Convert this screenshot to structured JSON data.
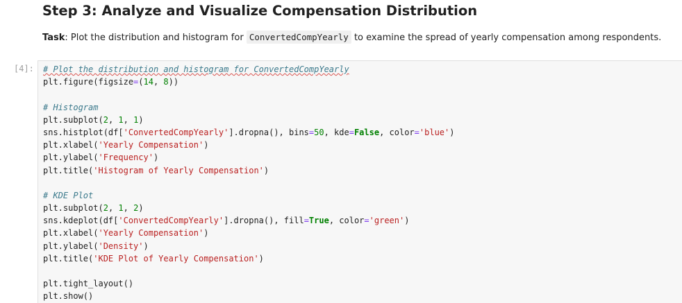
{
  "heading": "Step 3: Analyze and Visualize Compensation Distribution",
  "task": {
    "label": "Task",
    "before": ": Plot the distribution and histogram for ",
    "code": "ConvertedCompYearly",
    "after": " to examine the spread of yearly compensation among respondents."
  },
  "cell": {
    "prompt": "[4]:",
    "lines": [
      "# Plot the distribution and histogram for ConvertedCompYearly",
      "plt.figure(figsize=(14, 8))",
      "",
      "# Histogram",
      "plt.subplot(2, 1, 1)",
      "sns.histplot(df['ConvertedCompYearly'].dropna(), bins=50, kde=False, color='blue')",
      "plt.xlabel('Yearly Compensation')",
      "plt.ylabel('Frequency')",
      "plt.title('Histogram of Yearly Compensation')",
      "",
      "# KDE Plot",
      "plt.subplot(2, 1, 2)",
      "sns.kdeplot(df['ConvertedCompYearly'].dropna(), fill=True, color='green')",
      "plt.xlabel('Yearly Compensation')",
      "plt.ylabel('Density')",
      "plt.title('KDE Plot of Yearly Compensation')",
      "",
      "plt.tight_layout()",
      "plt.show()"
    ]
  },
  "colors": {
    "comment": "#3c7a8c",
    "string": "#ba2121",
    "number": "#008000",
    "keyword": "#008000",
    "cell_background": "#f7f7f7"
  }
}
